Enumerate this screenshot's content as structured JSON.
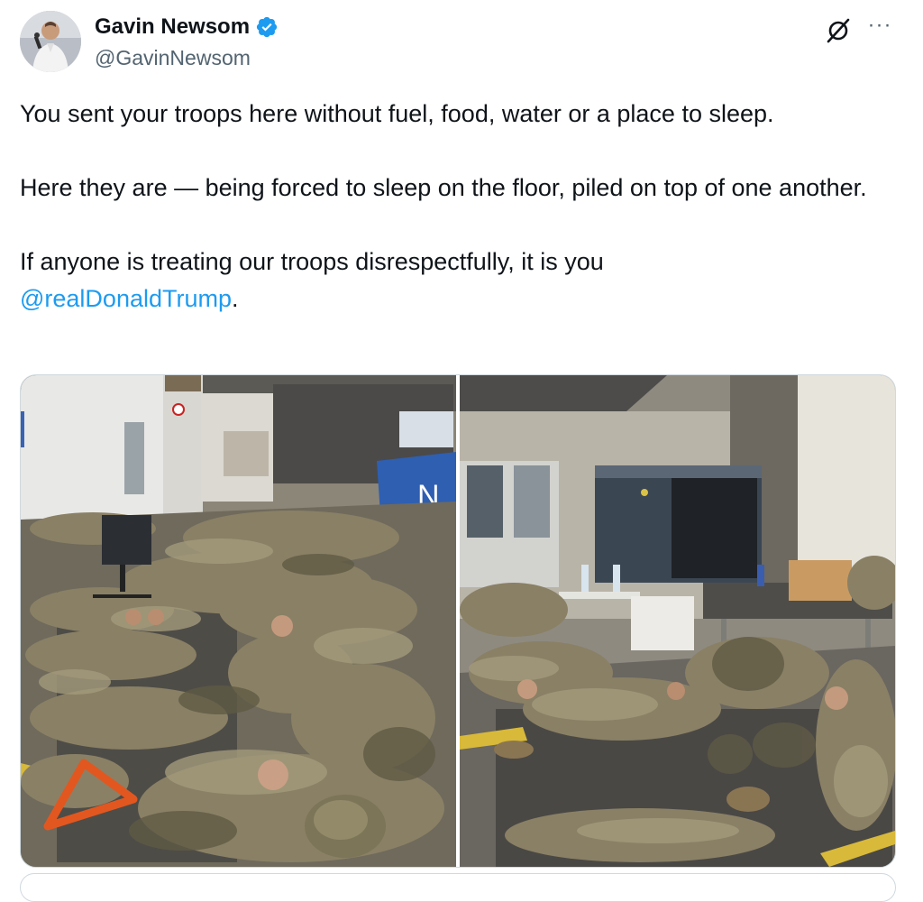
{
  "author": {
    "display_name": "Gavin Newsom",
    "handle": "@GavinNewsom",
    "verified": true,
    "avatar_icon": "avatar-photo"
  },
  "actions": {
    "grok_icon": "grok-icon",
    "more_icon": "more-options-icon",
    "more_label": "···"
  },
  "tweet": {
    "paragraph_1": "You sent your troops here without fuel, food, water or a place to sleep.",
    "paragraph_2": "Here they are — being forced to sleep on the floor, piled on top of one another.",
    "paragraph_3_text": "If anyone is treating our troops disrespectfully, it is you ",
    "mention": "@realDonaldTrump",
    "paragraph_3_end": "."
  },
  "media": {
    "photos": [
      {
        "description_icon": "photo-soldiers-sleeping-hallway",
        "sign_letter": "N"
      },
      {
        "description_icon": "photo-soldiers-sleeping-xray-room"
      }
    ]
  },
  "colors": {
    "accent": "#1d9bf0",
    "text": "#0f1419",
    "secondary_text": "#536471",
    "border": "#cfd9de"
  }
}
